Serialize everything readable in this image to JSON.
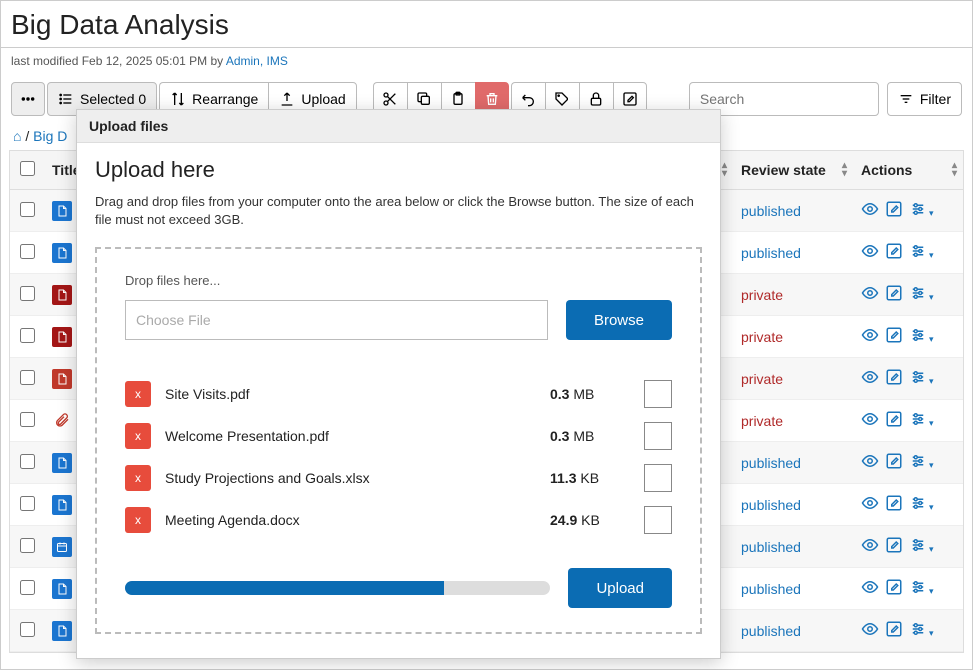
{
  "page": {
    "title": "Big Data Analysis",
    "last_modified_prefix": "last modified Feb 12, 2025 05:01 PM by ",
    "last_modified_user": "Admin, IMS"
  },
  "toolbar": {
    "selected_label": "Selected 0",
    "rearrange_label": "Rearrange",
    "upload_label": "Upload",
    "search_placeholder": "Search",
    "filter_label": "Filter"
  },
  "breadcrumb": {
    "separator": " / ",
    "current": "Big D"
  },
  "columns": {
    "title": "Title",
    "review_state": "Review state",
    "actions": "Actions"
  },
  "rows": [
    {
      "icon": "doc-blue",
      "state": "published"
    },
    {
      "icon": "doc-blue",
      "state": "published"
    },
    {
      "icon": "doc-red",
      "state": "private"
    },
    {
      "icon": "doc-red",
      "state": "private"
    },
    {
      "icon": "doc-darkred",
      "state": "private"
    },
    {
      "icon": "doc-clip",
      "state": "private"
    },
    {
      "icon": "doc-blue",
      "state": "published"
    },
    {
      "icon": "doc-blue",
      "state": "published"
    },
    {
      "icon": "doc-cal",
      "state": "published"
    },
    {
      "icon": "doc-blue",
      "state": "published"
    },
    {
      "icon": "doc-blue",
      "state": "published"
    }
  ],
  "dialog": {
    "header": "Upload files",
    "title": "Upload here",
    "description": "Drag and drop files from your computer onto the area below or click the Browse button. The size of each file must not exceed 3GB.",
    "drop_label": "Drop files here...",
    "choose_placeholder": "Choose File",
    "browse_label": "Browse",
    "upload_label": "Upload",
    "progress_percent": 75,
    "files": [
      {
        "name": "Site Visits.pdf",
        "size_num": "0.3",
        "size_unit": "MB"
      },
      {
        "name": "Welcome Presentation.pdf",
        "size_num": "0.3",
        "size_unit": "MB"
      },
      {
        "name": "Study Projections and Goals.xlsx",
        "size_num": "11.3",
        "size_unit": "KB"
      },
      {
        "name": "Meeting Agenda.docx",
        "size_num": "24.9",
        "size_unit": "KB"
      }
    ]
  }
}
